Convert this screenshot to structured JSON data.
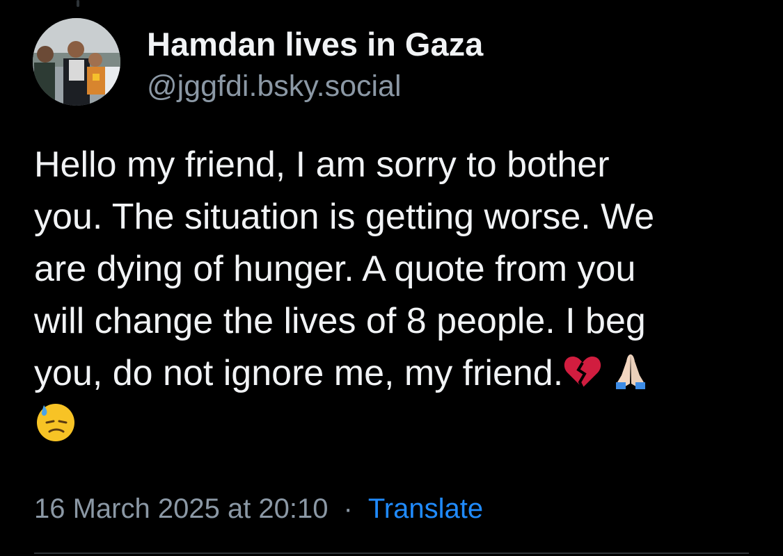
{
  "post": {
    "author": {
      "display_name": "Hamdan lives in Gaza",
      "handle": "@jggfdi.bsky.social",
      "avatar_icon": "profile-photo"
    },
    "text_lines": [
      "Hello my friend, I am sorry to bother",
      "you. The situation is getting worse. We",
      "are dying of hunger. A quote from you",
      "will change the lives of 8 people. I beg",
      "you, do not ignore me, my friend."
    ],
    "emojis": [
      "broken-heart",
      "folded-hands",
      "downcast-face-with-sweat"
    ],
    "timestamp": "16 March 2025 at 20:10",
    "separator": "·",
    "translate_label": "Translate"
  },
  "colors": {
    "background": "#000000",
    "text": "#f1f3f5",
    "muted": "#8b98a5",
    "link": "#208bfe",
    "divider": "#2e3438"
  }
}
